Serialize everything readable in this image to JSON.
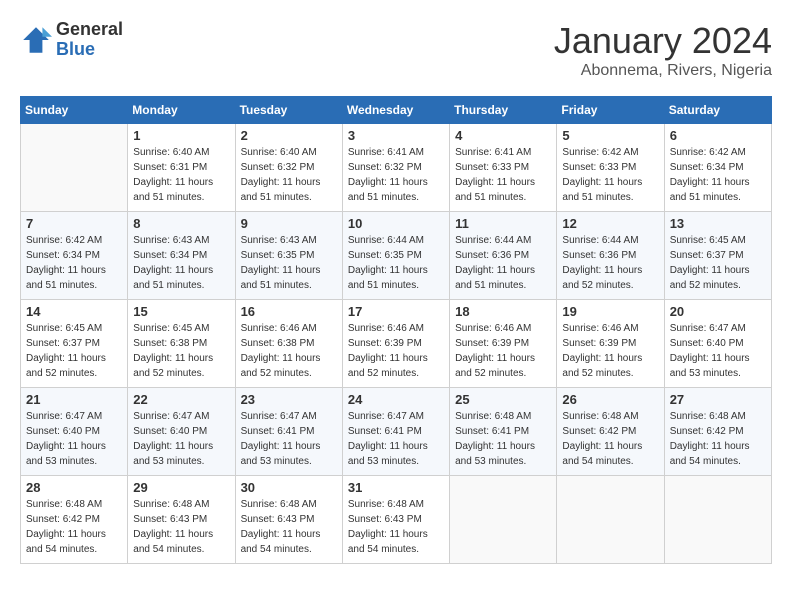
{
  "logo": {
    "general": "General",
    "blue": "Blue"
  },
  "title": "January 2024",
  "subtitle": "Abonnema, Rivers, Nigeria",
  "days_of_week": [
    "Sunday",
    "Monday",
    "Tuesday",
    "Wednesday",
    "Thursday",
    "Friday",
    "Saturday"
  ],
  "weeks": [
    [
      {
        "num": "",
        "empty": true
      },
      {
        "num": "1",
        "sunrise": "6:40 AM",
        "sunset": "6:31 PM",
        "daylight": "11 hours and 51 minutes."
      },
      {
        "num": "2",
        "sunrise": "6:40 AM",
        "sunset": "6:32 PM",
        "daylight": "11 hours and 51 minutes."
      },
      {
        "num": "3",
        "sunrise": "6:41 AM",
        "sunset": "6:32 PM",
        "daylight": "11 hours and 51 minutes."
      },
      {
        "num": "4",
        "sunrise": "6:41 AM",
        "sunset": "6:33 PM",
        "daylight": "11 hours and 51 minutes."
      },
      {
        "num": "5",
        "sunrise": "6:42 AM",
        "sunset": "6:33 PM",
        "daylight": "11 hours and 51 minutes."
      },
      {
        "num": "6",
        "sunrise": "6:42 AM",
        "sunset": "6:34 PM",
        "daylight": "11 hours and 51 minutes."
      }
    ],
    [
      {
        "num": "7",
        "sunrise": "6:42 AM",
        "sunset": "6:34 PM",
        "daylight": "11 hours and 51 minutes."
      },
      {
        "num": "8",
        "sunrise": "6:43 AM",
        "sunset": "6:34 PM",
        "daylight": "11 hours and 51 minutes."
      },
      {
        "num": "9",
        "sunrise": "6:43 AM",
        "sunset": "6:35 PM",
        "daylight": "11 hours and 51 minutes."
      },
      {
        "num": "10",
        "sunrise": "6:44 AM",
        "sunset": "6:35 PM",
        "daylight": "11 hours and 51 minutes."
      },
      {
        "num": "11",
        "sunrise": "6:44 AM",
        "sunset": "6:36 PM",
        "daylight": "11 hours and 51 minutes."
      },
      {
        "num": "12",
        "sunrise": "6:44 AM",
        "sunset": "6:36 PM",
        "daylight": "11 hours and 52 minutes."
      },
      {
        "num": "13",
        "sunrise": "6:45 AM",
        "sunset": "6:37 PM",
        "daylight": "11 hours and 52 minutes."
      }
    ],
    [
      {
        "num": "14",
        "sunrise": "6:45 AM",
        "sunset": "6:37 PM",
        "daylight": "11 hours and 52 minutes."
      },
      {
        "num": "15",
        "sunrise": "6:45 AM",
        "sunset": "6:38 PM",
        "daylight": "11 hours and 52 minutes."
      },
      {
        "num": "16",
        "sunrise": "6:46 AM",
        "sunset": "6:38 PM",
        "daylight": "11 hours and 52 minutes."
      },
      {
        "num": "17",
        "sunrise": "6:46 AM",
        "sunset": "6:39 PM",
        "daylight": "11 hours and 52 minutes."
      },
      {
        "num": "18",
        "sunrise": "6:46 AM",
        "sunset": "6:39 PM",
        "daylight": "11 hours and 52 minutes."
      },
      {
        "num": "19",
        "sunrise": "6:46 AM",
        "sunset": "6:39 PM",
        "daylight": "11 hours and 52 minutes."
      },
      {
        "num": "20",
        "sunrise": "6:47 AM",
        "sunset": "6:40 PM",
        "daylight": "11 hours and 53 minutes."
      }
    ],
    [
      {
        "num": "21",
        "sunrise": "6:47 AM",
        "sunset": "6:40 PM",
        "daylight": "11 hours and 53 minutes."
      },
      {
        "num": "22",
        "sunrise": "6:47 AM",
        "sunset": "6:40 PM",
        "daylight": "11 hours and 53 minutes."
      },
      {
        "num": "23",
        "sunrise": "6:47 AM",
        "sunset": "6:41 PM",
        "daylight": "11 hours and 53 minutes."
      },
      {
        "num": "24",
        "sunrise": "6:47 AM",
        "sunset": "6:41 PM",
        "daylight": "11 hours and 53 minutes."
      },
      {
        "num": "25",
        "sunrise": "6:48 AM",
        "sunset": "6:41 PM",
        "daylight": "11 hours and 53 minutes."
      },
      {
        "num": "26",
        "sunrise": "6:48 AM",
        "sunset": "6:42 PM",
        "daylight": "11 hours and 54 minutes."
      },
      {
        "num": "27",
        "sunrise": "6:48 AM",
        "sunset": "6:42 PM",
        "daylight": "11 hours and 54 minutes."
      }
    ],
    [
      {
        "num": "28",
        "sunrise": "6:48 AM",
        "sunset": "6:42 PM",
        "daylight": "11 hours and 54 minutes."
      },
      {
        "num": "29",
        "sunrise": "6:48 AM",
        "sunset": "6:43 PM",
        "daylight": "11 hours and 54 minutes."
      },
      {
        "num": "30",
        "sunrise": "6:48 AM",
        "sunset": "6:43 PM",
        "daylight": "11 hours and 54 minutes."
      },
      {
        "num": "31",
        "sunrise": "6:48 AM",
        "sunset": "6:43 PM",
        "daylight": "11 hours and 54 minutes."
      },
      {
        "num": "",
        "empty": true
      },
      {
        "num": "",
        "empty": true
      },
      {
        "num": "",
        "empty": true
      }
    ]
  ]
}
